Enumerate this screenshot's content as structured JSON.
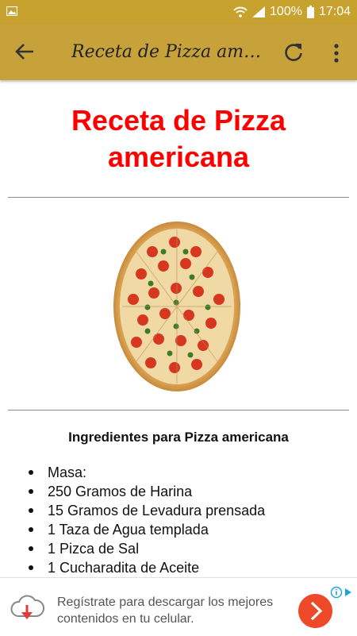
{
  "status_bar": {
    "battery": "100%",
    "time": "17:04"
  },
  "app_bar": {
    "title": "Receta de Pizza americana"
  },
  "content": {
    "heading": "Receta de Pizza americana",
    "ingredients_title": "Ingredientes para Pizza americana",
    "ingredients": [
      "Masa:",
      "250 Gramos de Harina",
      "15 Gramos de Levadura prensada",
      "1 Taza de Agua templada",
      "1 Pizca de Sal",
      "1 Cucharadita de Aceite"
    ]
  },
  "ad": {
    "text": "Regístrate para descargar los mejores contenidos en tu celular."
  },
  "colors": {
    "status_bar": "#c8a22f",
    "app_bar": "#c7a23a",
    "heading": "#ff0000",
    "ad_button": "#ee4a2a"
  },
  "icons": [
    "gallery-icon",
    "wifi-icon",
    "signal-icon",
    "battery-icon",
    "back-arrow-icon",
    "refresh-icon",
    "more-vert-icon",
    "cloud-download-icon",
    "chevron-right-icon",
    "adchoices-icon"
  ]
}
